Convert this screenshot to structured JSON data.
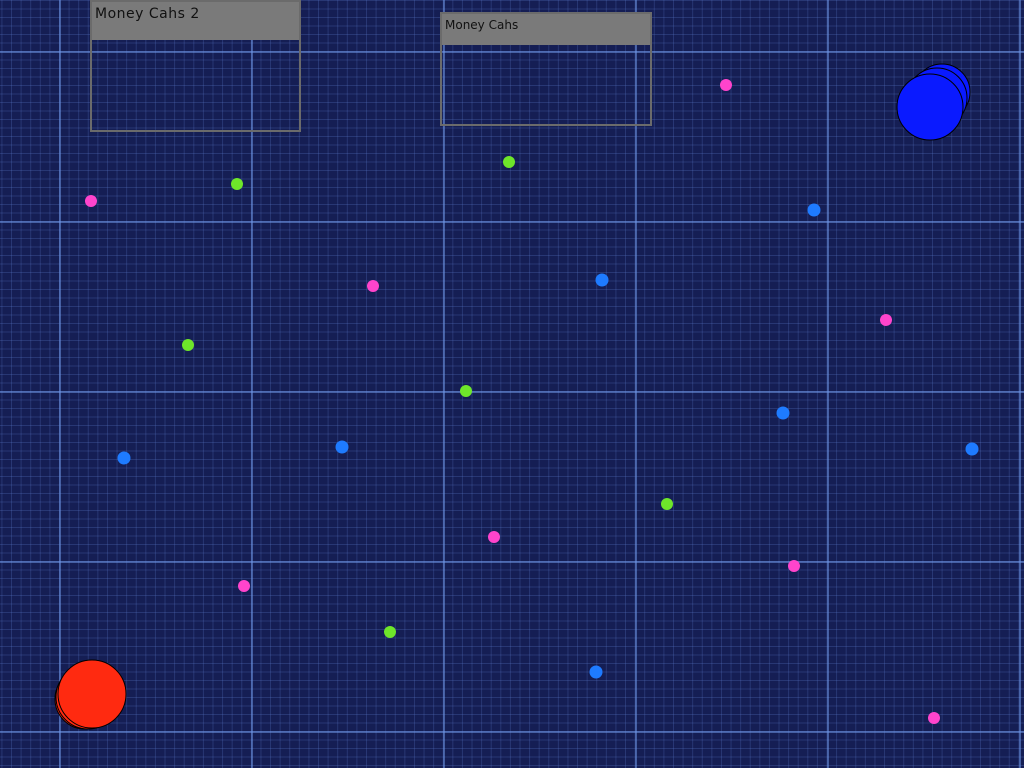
{
  "scoreboards": {
    "player2": {
      "title": "Money Cahs 2"
    },
    "player1": {
      "title": "Money Cahs"
    }
  },
  "colors": {
    "background": "#151e54",
    "player_blue": "#0a1aff",
    "player_red": "#ff2a10",
    "coin_pink": "#ff44cc",
    "coin_blue": "#1e7bff",
    "coin_green": "#6ee62a"
  }
}
